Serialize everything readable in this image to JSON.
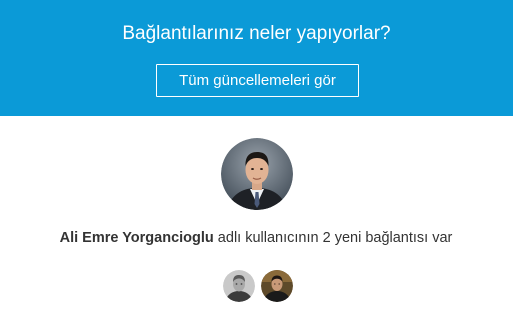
{
  "banner": {
    "title": "Bağlantılarınız neler yapıyorlar?",
    "button_label": "Tüm güncellemeleri gör"
  },
  "update": {
    "person_name": "Ali Emre Yorgancioglu",
    "message_text": " adlı kullanıcının 2 yeni bağlantısı var"
  },
  "colors": {
    "banner_background": "#0b9ad7",
    "banner_text": "#ffffff",
    "body_text": "#333333"
  }
}
